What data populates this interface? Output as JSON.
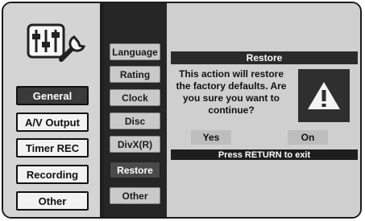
{
  "left_menu": {
    "items": [
      {
        "label": "General",
        "selected": true
      },
      {
        "label": "A/V Output",
        "selected": false
      },
      {
        "label": "Timer REC",
        "selected": false
      },
      {
        "label": "Recording",
        "selected": false
      },
      {
        "label": "Other",
        "selected": false
      }
    ]
  },
  "submenu": {
    "items": [
      {
        "label": "Language",
        "selected": false
      },
      {
        "label": "Rating",
        "selected": false
      },
      {
        "label": "Clock",
        "selected": false
      },
      {
        "label": "Disc",
        "selected": false
      },
      {
        "label": "DivX(R)",
        "selected": false
      },
      {
        "label": "Restore",
        "selected": true
      },
      {
        "label": "Other",
        "selected": false
      }
    ]
  },
  "dialog": {
    "title": "Restore",
    "message_lines": [
      "This action will restore",
      "the factory defaults. Are",
      "you sure you want to",
      "continue?"
    ],
    "yes_label": "Yes",
    "no_label": "On",
    "hint": "Press RETURN to exit"
  },
  "icons": [
    "settings-sliders-wrench-icon",
    "warning-triangle-icon"
  ],
  "colors": {
    "selected_bg": "#3a3a3a",
    "panel_dark": "#262626",
    "background": "#dcdcdc"
  }
}
